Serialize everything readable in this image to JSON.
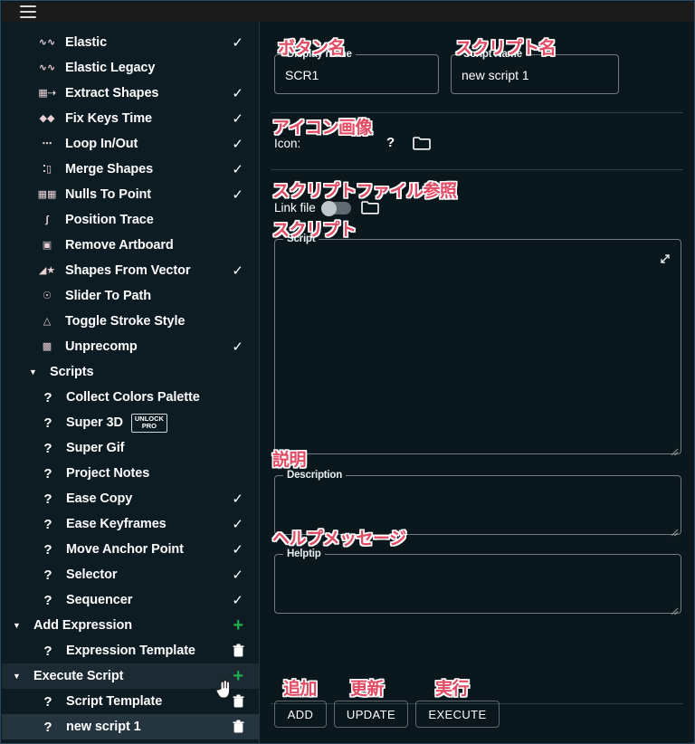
{
  "window": {
    "menu_icon": "hamburger-icon"
  },
  "sidebar": {
    "items": [
      {
        "icon": "waveform-icon",
        "label": "Elastic",
        "checked": true,
        "kind": "tool"
      },
      {
        "icon": "waveform-icon",
        "label": "Elastic Legacy",
        "checked": false,
        "kind": "tool"
      },
      {
        "icon": "extract-shapes-icon",
        "label": "Extract Shapes",
        "checked": true,
        "kind": "tool"
      },
      {
        "icon": "keys-icon",
        "label": "Fix Keys Time",
        "checked": true,
        "kind": "tool"
      },
      {
        "icon": "dots-icon",
        "label": "Loop In/Out",
        "checked": true,
        "kind": "tool"
      },
      {
        "icon": "merge-shapes-icon",
        "label": "Merge Shapes",
        "checked": true,
        "kind": "tool"
      },
      {
        "icon": "nulls-icon",
        "label": "Nulls To Point",
        "checked": true,
        "kind": "tool"
      },
      {
        "icon": "curve-icon",
        "label": "Position Trace",
        "checked": false,
        "kind": "tool"
      },
      {
        "icon": "artboard-icon",
        "label": "Remove Artboard",
        "checked": false,
        "kind": "tool"
      },
      {
        "icon": "vector-icon",
        "label": "Shapes From Vector",
        "checked": true,
        "kind": "tool"
      },
      {
        "icon": "slider-icon",
        "label": "Slider To Path",
        "checked": false,
        "kind": "tool"
      },
      {
        "icon": "stroke-icon",
        "label": "Toggle Stroke Style",
        "checked": false,
        "kind": "tool"
      },
      {
        "icon": "unprecomp-icon",
        "label": "Unprecomp",
        "checked": true,
        "kind": "tool"
      }
    ],
    "groups": [
      {
        "label": "Scripts",
        "expanded": true,
        "action": "",
        "items": [
          {
            "icon": "question-icon",
            "label": "Collect Colors Palette",
            "checked": false,
            "badge": ""
          },
          {
            "icon": "question-icon",
            "label": "Super 3D",
            "checked": false,
            "badge": "UNLOCK\nPRO"
          },
          {
            "icon": "question-icon",
            "label": "Super Gif",
            "checked": false,
            "badge": ""
          },
          {
            "icon": "question-icon",
            "label": "Project Notes",
            "checked": false,
            "badge": ""
          },
          {
            "icon": "question-icon",
            "label": "Ease Copy",
            "checked": true,
            "badge": ""
          },
          {
            "icon": "question-icon",
            "label": "Ease Keyframes",
            "checked": true,
            "badge": ""
          },
          {
            "icon": "question-icon",
            "label": "Move Anchor Point",
            "checked": true,
            "badge": ""
          },
          {
            "icon": "question-icon",
            "label": "Selector",
            "checked": true,
            "badge": ""
          },
          {
            "icon": "question-icon",
            "label": "Sequencer",
            "checked": true,
            "badge": ""
          }
        ]
      },
      {
        "label": "Add Expression",
        "expanded": true,
        "action": "plus-icon",
        "items": [
          {
            "icon": "question-icon",
            "label": "Expression Template",
            "trash": true
          }
        ]
      },
      {
        "label": "Execute Script",
        "expanded": true,
        "action": "plus-icon",
        "highlighted": true,
        "items": [
          {
            "icon": "question-icon",
            "label": "Script Template",
            "trash": true
          },
          {
            "icon": "question-icon",
            "label": "new script 1",
            "trash": true,
            "selected": true
          }
        ]
      }
    ]
  },
  "panel": {
    "display_name": {
      "label": "Display name",
      "value": "SCR1",
      "placeholder": ""
    },
    "script_name": {
      "label": "Script Name",
      "value": "new script 1",
      "placeholder": ""
    },
    "icon_row": {
      "label": "Icon:",
      "question": "?",
      "browse": "folder-icon"
    },
    "link_file": {
      "label": "Link file",
      "toggle_on": false,
      "browse": "folder-icon"
    },
    "script": {
      "label": "Script",
      "value": "",
      "expand": "expand-icon"
    },
    "description": {
      "label": "Description",
      "value": ""
    },
    "helptip": {
      "label": "Helptip",
      "value": ""
    },
    "buttons": [
      {
        "label": "ADD",
        "name": "add-button"
      },
      {
        "label": "UPDATE",
        "name": "update-button"
      },
      {
        "label": "EXECUTE",
        "name": "execute-button"
      }
    ]
  },
  "annotations": {
    "button_name": "ボタン名",
    "script_name": "スクリプト名",
    "icon_image": "アイコン画像",
    "script_file_ref": "スクリプトファイル参照",
    "script": "スクリプト",
    "description": "説明",
    "help_message": "ヘルプメッセージ",
    "add": "追加",
    "update": "更新",
    "execute": "実行"
  },
  "colors": {
    "background": "#0a171c",
    "annotation": "#e24a63",
    "accent_green": "#1faf4d",
    "selected_row": "#25353f"
  }
}
